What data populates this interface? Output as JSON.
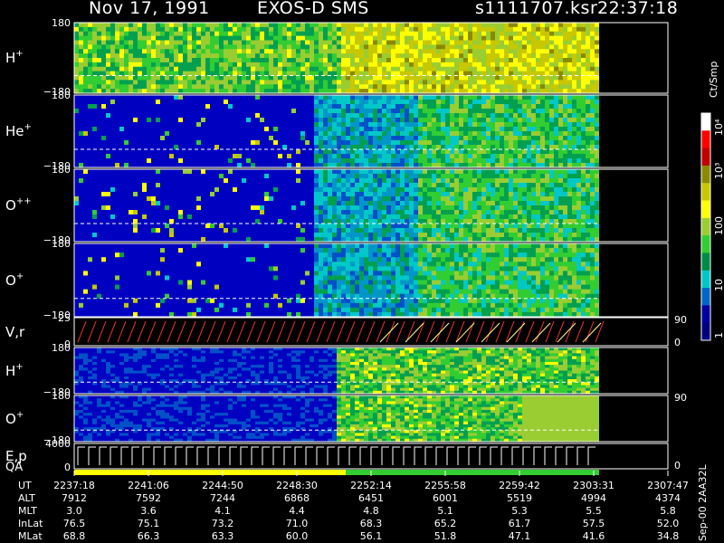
{
  "header": {
    "date": "Nov 17, 1991",
    "instrument": "EXOS-D SMS",
    "file": "s1111707.ksr",
    "time": "22:37:18"
  },
  "panels": [
    {
      "key": "h1",
      "label": "H",
      "sup": "+",
      "top_tick": "180",
      "bottom_tick": "−180",
      "right_tick": ""
    },
    {
      "key": "he",
      "label": "He",
      "sup": "+",
      "top_tick": "180",
      "bottom_tick": "−180",
      "right_tick": ""
    },
    {
      "key": "opp",
      "label": "O",
      "sup": "++",
      "top_tick": "180",
      "bottom_tick": "−180",
      "right_tick": ""
    },
    {
      "key": "o1",
      "label": "O",
      "sup": "+",
      "top_tick": "180",
      "bottom_tick": "−180",
      "right_tick": ""
    },
    {
      "key": "vr",
      "label": "V,r",
      "sup": "",
      "top_tick": "25",
      "bottom_tick": "0",
      "right_top": "90",
      "right_bottom": "0"
    },
    {
      "key": "h2",
      "label": "H",
      "sup": "+",
      "top_tick": "180",
      "bottom_tick": "−180",
      "right_tick": ""
    },
    {
      "key": "o2",
      "label": "O",
      "sup": "+",
      "top_tick": "180",
      "bottom_tick": "−180",
      "right_top": "90"
    },
    {
      "key": "ep",
      "label": "E,p",
      "sup": "",
      "top_tick": "4000",
      "bottom_tick": "0",
      "right_bottom": "0"
    }
  ],
  "qa_label": "QA",
  "colorbar": {
    "unit": "Ct/Smp",
    "ticks": [
      "10⁴",
      "10³",
      "100",
      "10",
      "1"
    ],
    "colors": [
      "#ffffff",
      "#ff0000",
      "#c00000",
      "#8a8a00",
      "#c8c800",
      "#ffff00",
      "#9acd32",
      "#32cd32",
      "#008b45",
      "#00c8c8",
      "#0064c8",
      "#0000a0",
      "#000080"
    ]
  },
  "side_text": "Sep-00  2AA32L",
  "table": {
    "rows": [
      {
        "name": "UT",
        "values": [
          "2237:18",
          "2241:06",
          "2244:50",
          "2248:30",
          "2252:14",
          "2255:58",
          "2259:42",
          "2303:31",
          "2307:47"
        ]
      },
      {
        "name": "ALT",
        "values": [
          "7912",
          "7592",
          "7244",
          "6868",
          "6451",
          "6001",
          "5519",
          "4994",
          "4374"
        ]
      },
      {
        "name": "MLT",
        "values": [
          "3.0",
          "3.6",
          "4.1",
          "4.4",
          "4.8",
          "5.1",
          "5.3",
          "5.5",
          "5.8"
        ]
      },
      {
        "name": "InLat",
        "values": [
          "76.5",
          "75.1",
          "73.2",
          "71.0",
          "68.3",
          "65.2",
          "61.7",
          "57.5",
          "52.0"
        ]
      },
      {
        "name": "MLat",
        "values": [
          "68.8",
          "66.3",
          "63.3",
          "60.0",
          "56.1",
          "51.8",
          "47.1",
          "41.6",
          "34.8"
        ]
      }
    ]
  },
  "chart_data": {
    "type": "heatmap",
    "title": "Nov 17, 1991   EXOS-D SMS",
    "x_ticks": [
      "2237:18",
      "2241:06",
      "2244:50",
      "2248:30",
      "2252:14",
      "2255:58",
      "2259:42",
      "2303:31",
      "2307:47"
    ],
    "series": [
      {
        "name": "H+",
        "ylim": [
          -180,
          180
        ]
      },
      {
        "name": "He+",
        "ylim": [
          -180,
          180
        ]
      },
      {
        "name": "O++",
        "ylim": [
          -180,
          180
        ]
      },
      {
        "name": "O+",
        "ylim": [
          -180,
          180
        ]
      },
      {
        "name": "V,r",
        "ylim": [
          0,
          25
        ]
      },
      {
        "name": "H+",
        "ylim": [
          -180,
          180
        ]
      },
      {
        "name": "O+",
        "ylim": [
          -180,
          180
        ]
      },
      {
        "name": "E,p",
        "ylim": [
          0,
          4000
        ]
      }
    ],
    "colorbar_range": [
      1,
      10000
    ],
    "colorbar_scale": "log"
  }
}
